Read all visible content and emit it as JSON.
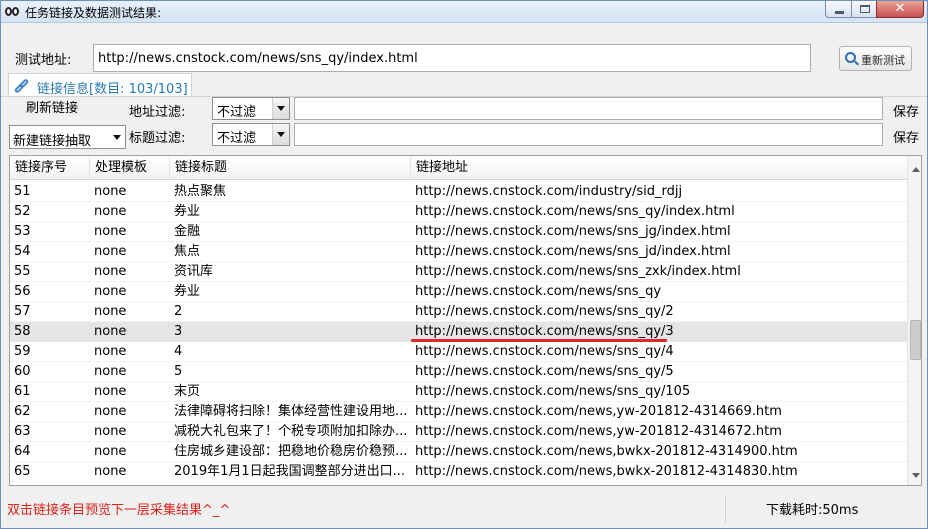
{
  "window": {
    "title": "任务链接及数据测试结果:",
    "close_glyph": "✕"
  },
  "toolbar": {
    "url_label": "测试地址:",
    "url_value": "http://news.cnstock.com/news/sns_qy/index.html",
    "retest_label": "重新测试"
  },
  "tab": {
    "label": "链接信息[数目: 103/103]"
  },
  "filters": {
    "refresh_label": "刷新链接",
    "extract_value": "新建链接抽取",
    "address_label": "地址过滤:",
    "address_mode": "不过滤",
    "title_label": "标题过滤:",
    "title_mode": "不过滤",
    "save_label_1": "保存",
    "save_label_2": "保存"
  },
  "table": {
    "headers": [
      "链接序号",
      "处理模板",
      "链接标题",
      "链接地址"
    ],
    "rows": [
      [
        "51",
        "none",
        "热点聚焦",
        "http://news.cnstock.com/industry/sid_rdjj"
      ],
      [
        "52",
        "none",
        "券业",
        "http://news.cnstock.com/news/sns_qy/index.html"
      ],
      [
        "53",
        "none",
        "金融",
        "http://news.cnstock.com/news/sns_jg/index.html"
      ],
      [
        "54",
        "none",
        "焦点",
        "http://news.cnstock.com/news/sns_jd/index.html"
      ],
      [
        "55",
        "none",
        "资讯库",
        "http://news.cnstock.com/news/sns_zxk/index.html"
      ],
      [
        "56",
        "none",
        "券业",
        "http://news.cnstock.com/news/sns_qy"
      ],
      [
        "57",
        "none",
        "2",
        "http://news.cnstock.com/news/sns_qy/2"
      ],
      [
        "58",
        "none",
        "3",
        "http://news.cnstock.com/news/sns_qy/3"
      ],
      [
        "59",
        "none",
        "4",
        "http://news.cnstock.com/news/sns_qy/4"
      ],
      [
        "60",
        "none",
        "5",
        "http://news.cnstock.com/news/sns_qy/5"
      ],
      [
        "61",
        "none",
        "末页",
        "http://news.cnstock.com/news/sns_qy/105"
      ],
      [
        "62",
        "none",
        "法律障碍将扫除！集体经营性建设用地...",
        "http://news.cnstock.com/news,yw-201812-4314669.htm"
      ],
      [
        "63",
        "none",
        "减税大礼包来了！个税专项附加扣除办...",
        "http://news.cnstock.com/news,yw-201812-4314672.htm"
      ],
      [
        "64",
        "none",
        "住房城乡建设部：把稳地价稳房价稳预...",
        "http://news.cnstock.com/news,bwkx-201812-4314900.htm"
      ],
      [
        "65",
        "none",
        "2019年1月1日起我国调整部分进出口...",
        "http://news.cnstock.com/news,bwkx-201812-4314830.htm"
      ]
    ],
    "selected_index": 7
  },
  "status": {
    "hint": "双击链接条目预览下一层采集结果^_^",
    "time": "下载耗时:50ms"
  },
  "colors": {
    "accent": "#2a79b5",
    "hint_red": "#e0201a",
    "annotation_red": "#e02828"
  }
}
